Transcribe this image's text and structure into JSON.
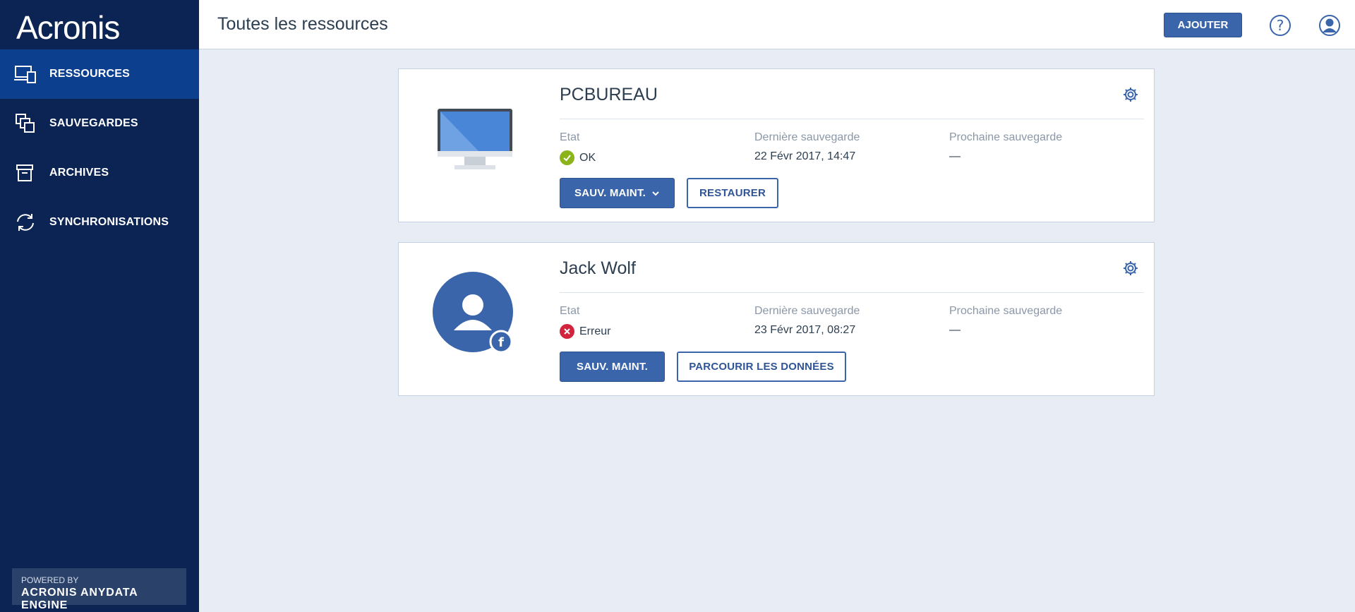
{
  "app": {
    "logo": "Acronis"
  },
  "sidebar": {
    "items": [
      {
        "label": "RESSOURCES",
        "icon": "devices-icon",
        "active": true
      },
      {
        "label": "SAUVEGARDES",
        "icon": "backups-icon",
        "active": false
      },
      {
        "label": "ARCHIVES",
        "icon": "archive-box-icon",
        "active": false
      },
      {
        "label": "SYNCHRONISATIONS",
        "icon": "sync-icon",
        "active": false
      }
    ],
    "powered_by": "POWERED BY",
    "engine": "ACRONIS ANYDATA ENGINE"
  },
  "header": {
    "title": "Toutes les ressources",
    "add_label": "AJOUTER",
    "help_icon": "help-circle-icon",
    "user_icon": "user-account-icon"
  },
  "labels": {
    "state": "Etat",
    "last_backup": "Dernière sauvegarde",
    "next_backup": "Prochaine sauvegarde"
  },
  "resources": [
    {
      "name": "PCBUREAU",
      "type": "computer",
      "status": "OK",
      "status_kind": "ok",
      "last_backup": "22 Févr 2017, 14:47",
      "next_backup": "—",
      "primary_action": "SAUV. MAINT.",
      "secondary_action": "RESTAURER"
    },
    {
      "name": "Jack Wolf",
      "type": "facebook-account",
      "status": "Erreur",
      "status_kind": "error",
      "last_backup": "23 Févr 2017, 08:27",
      "next_backup": "—",
      "primary_action": "SAUV. MAINT.",
      "secondary_action": "PARCOURIR LES DONNÉES"
    }
  ],
  "colors": {
    "sidebar_bg": "#0c2454",
    "sidebar_active": "#0d3f8f",
    "accent": "#3a65ab",
    "ok": "#8ab41a",
    "error": "#d2243c",
    "content_bg": "#e8edf5"
  }
}
